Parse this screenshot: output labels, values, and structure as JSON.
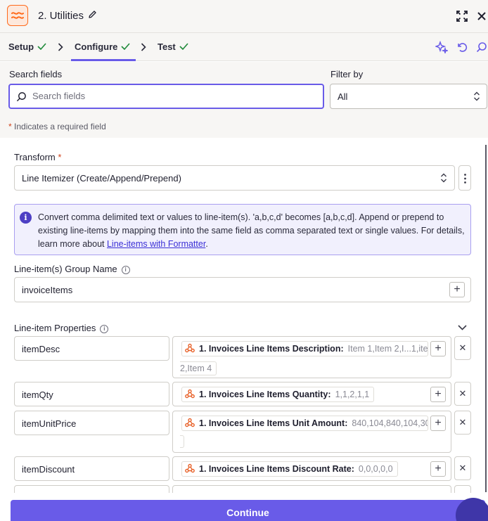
{
  "header": {
    "title": "2. Utilities",
    "icons": {
      "app": "utilities-app-icon",
      "edit": "pencil-icon",
      "expand": "expand-icon",
      "close": "close-icon"
    }
  },
  "tabs": [
    {
      "label": "Setup",
      "status": "complete"
    },
    {
      "label": "Configure",
      "status": "complete",
      "active": true
    },
    {
      "label": "Test",
      "status": "complete"
    }
  ],
  "toolbar_icons": [
    "sparkle-icon",
    "undo-icon",
    "search-icon"
  ],
  "search": {
    "label": "Search fields",
    "placeholder": "Search fields",
    "value": ""
  },
  "filter": {
    "label": "Filter by",
    "value": "All"
  },
  "required_note": {
    "star": "*",
    "text": " Indicates a required field"
  },
  "transform": {
    "label": "Transform",
    "required_mark": "*",
    "value": "Line Itemizer (Create/Append/Prepend)"
  },
  "info": {
    "text": "Convert comma delimited text or values to line-item(s). 'a,b,c,d' becomes [a,b,c,d]. Append or prepend to existing line-items by mapping them into the same field as comma separated text or single values. For details, learn more about ",
    "link": "Line-items with Formatter",
    "after": "."
  },
  "group_name": {
    "label": "Line-item(s) Group Name",
    "value": "invoiceItems"
  },
  "properties": {
    "label": "Line-item Properties",
    "rows": [
      {
        "key": "itemDesc",
        "source": "1. Invoices Line Items Description:",
        "preview": "Item 1,Item 2,I...1,item",
        "preview_wrap": "2,Item 4"
      },
      {
        "key": "itemQty",
        "source": "1. Invoices Line Items Quantity:",
        "preview": "1,1,2,1,1"
      },
      {
        "key": "itemUnitPrice",
        "source": "1. Invoices Line Items Unit Amount:",
        "preview": "840,104,840,104,300"
      },
      {
        "key": "itemDiscount",
        "source": "1. Invoices Line Items Discount Rate:",
        "preview": "0,0,0,0,0"
      }
    ]
  },
  "continue_label": "Continue",
  "colors": {
    "accent": "#695be8",
    "brand_orange": "#ff6a1a",
    "check_green": "#1f8a3a"
  }
}
